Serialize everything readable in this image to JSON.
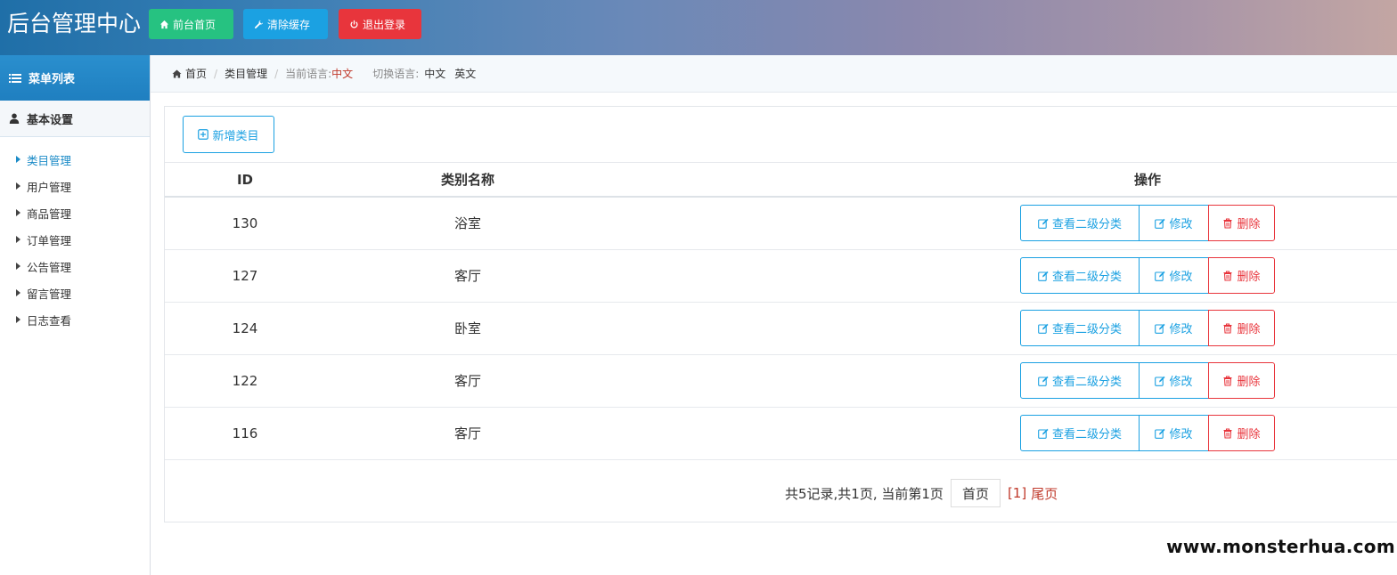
{
  "header": {
    "brand": "后台管理中心",
    "buttons": {
      "home": "前台首页",
      "clear_cache": "清除缓存",
      "logout": "退出登录"
    }
  },
  "sidebar": {
    "menu_title": "菜单列表",
    "group_title": "基本设置",
    "items": [
      {
        "label": "类目管理",
        "active": true
      },
      {
        "label": "用户管理"
      },
      {
        "label": "商品管理"
      },
      {
        "label": "订单管理"
      },
      {
        "label": "公告管理"
      },
      {
        "label": "留言管理"
      },
      {
        "label": "日志查看"
      }
    ]
  },
  "breadcrumb": {
    "home": "首页",
    "current": "类目管理",
    "lang_label": "当前语言:",
    "lang_value": "中文",
    "switch_label": "切换语言:",
    "switch_zh": "中文",
    "switch_en": "英文"
  },
  "toolbar": {
    "add_label": "新增类目"
  },
  "table": {
    "headers": {
      "id": "ID",
      "name": "类别名称",
      "op": "操作"
    },
    "rows": [
      {
        "id": "130",
        "name": "浴室"
      },
      {
        "id": "127",
        "name": "客厅"
      },
      {
        "id": "124",
        "name": "卧室"
      },
      {
        "id": "122",
        "name": "客厅"
      },
      {
        "id": "116",
        "name": "客厅"
      }
    ],
    "actions": {
      "view": "查看二级分类",
      "edit": "修改",
      "delete": "删除"
    }
  },
  "pager": {
    "summary": "共5记录,共1页, 当前第1页",
    "first": "首页",
    "current": "[1]",
    "last": "尾页"
  },
  "watermark": "www.monsterhua.com",
  "colors": {
    "green": "#26c281",
    "blue": "#1ba1e2",
    "red": "#e8353c"
  }
}
